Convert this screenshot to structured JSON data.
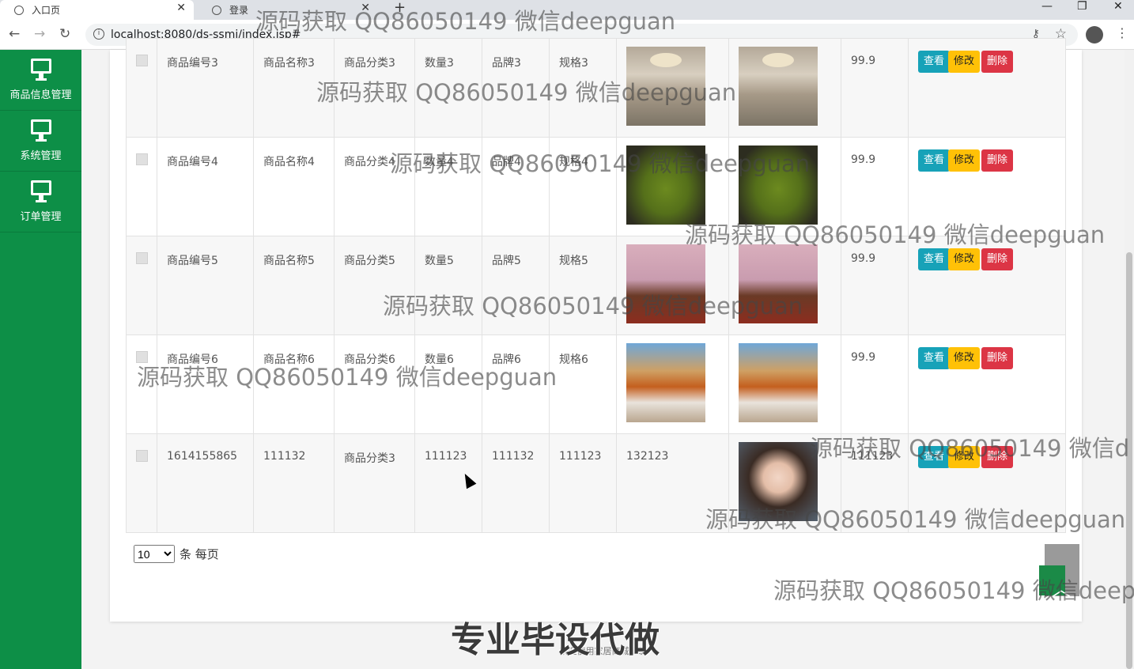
{
  "browser": {
    "tabs": [
      {
        "title": "入口页"
      },
      {
        "title": "登录"
      }
    ],
    "url": "localhost:8080/ds-ssmj/index.jsp#"
  },
  "sidebar": {
    "items": [
      {
        "label": "商品信息管理",
        "icon": "monitor-icon"
      },
      {
        "label": "系统管理",
        "icon": "monitor-icon"
      },
      {
        "label": "订单管理",
        "icon": "monitor-icon"
      }
    ]
  },
  "table": {
    "rows": [
      {
        "code": "商品编号3",
        "name": "商品名称3",
        "category": "商品分类3",
        "qty": "数量3",
        "brand": "品牌3",
        "spec": "规格3",
        "img1": "room",
        "img2": "room",
        "price": "99.9"
      },
      {
        "code": "商品编号4",
        "name": "商品名称4",
        "category": "商品分类4",
        "qty": "数量4",
        "brand": "品牌4",
        "spec": "规格4",
        "img1": "chair",
        "img2": "chair",
        "price": "99.9"
      },
      {
        "code": "商品编号5",
        "name": "商品名称5",
        "category": "商品分类5",
        "qty": "数量5",
        "brand": "品牌5",
        "spec": "规格5",
        "img1": "living",
        "img2": "living",
        "price": "99.9"
      },
      {
        "code": "商品编号6",
        "name": "商品名称6",
        "category": "商品分类6",
        "qty": "数量6",
        "brand": "品牌6",
        "spec": "规格6",
        "img1": "bed",
        "img2": "bed",
        "price": "99.9"
      },
      {
        "code": "1614155865",
        "name": "111132",
        "category": "商品分类3",
        "qty": "111123",
        "brand": "111132",
        "spec": "111123",
        "img1text": "132123",
        "img2": "face",
        "price": "111123"
      }
    ],
    "actions": {
      "view": "查看",
      "edit": "修改",
      "delete": "删除"
    }
  },
  "pager": {
    "page_size": "10",
    "options": [
      "10"
    ],
    "suffix": "条 每页"
  },
  "footer": "欢迎使用家居商城系统",
  "watermarks": {
    "text": "源码获取 QQ86050149 微信deepguan",
    "text_cut": "源码获取 QQ86050149 微信d",
    "text_cut2": "源码获取 QQ86050149 微信deep",
    "promo": "专业毕设代做"
  }
}
